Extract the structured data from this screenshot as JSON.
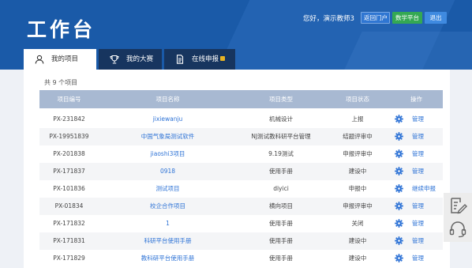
{
  "header": {
    "logo": "工作台",
    "greeting": "您好，演示教师3",
    "portal_button": "返回门户",
    "data_button": "数学平台",
    "logout_button": "退出"
  },
  "tabs": [
    {
      "label": "我的项目",
      "icon": "user-icon",
      "active": true
    },
    {
      "label": "我的大赛",
      "icon": "trophy-icon",
      "active": false
    },
    {
      "label": "在线申报",
      "icon": "document-icon",
      "active": false
    }
  ],
  "project_count": "共 9 个项目",
  "table": {
    "columns": [
      "项目编号",
      "项目名称",
      "项目类型",
      "项目状态",
      "操作"
    ],
    "rows": [
      {
        "id": "PX-231842",
        "name": "jixiewanju",
        "type": "机械设计",
        "status": "上报",
        "action": "管理"
      },
      {
        "id": "PX-19951839",
        "name": "中国气象局测试软件",
        "type": "NJ测试教科研平台管理",
        "status": "结题评审中",
        "action": "管理"
      },
      {
        "id": "PX-201838",
        "name": "jiaoshi3项目",
        "type": "9.19测试",
        "status": "申报评审中",
        "action": "管理"
      },
      {
        "id": "PX-171837",
        "name": "0918",
        "type": "使用手册",
        "status": "建设中",
        "action": "管理"
      },
      {
        "id": "PX-101836",
        "name": "测试项目",
        "type": "diyici",
        "status": "申报中",
        "action": "继续申报"
      },
      {
        "id": "PX-01834",
        "name": "校企合作项目",
        "type": "横向项目",
        "status": "申报评审中",
        "action": "管理"
      },
      {
        "id": "PX-171832",
        "name": "1",
        "type": "使用手册",
        "status": "关闭",
        "action": "管理"
      },
      {
        "id": "PX-171831",
        "name": "科研平台使用手册",
        "type": "使用手册",
        "status": "建设中",
        "action": "管理"
      },
      {
        "id": "PX-171829",
        "name": "教科研平台使用手册",
        "type": "使用手册",
        "status": "建设中",
        "action": "管理"
      }
    ]
  },
  "side_toolbar": {
    "icons": [
      "edit-icon",
      "headset-icon"
    ]
  },
  "colors": {
    "header": "#1a5aa8",
    "tab_dark": "#17355f",
    "link": "#2e73d6",
    "table_head": "#a8b9d2"
  }
}
